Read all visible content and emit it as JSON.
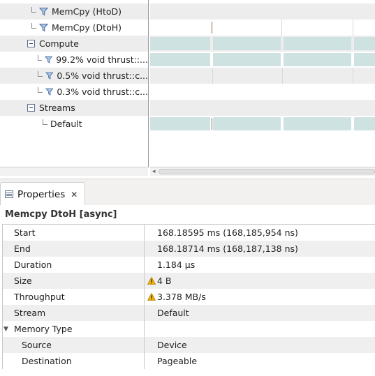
{
  "timeline": {
    "rows": [
      {
        "label": "MemCpy (HtoD)",
        "icon": "funnel-icon"
      },
      {
        "label": "MemCpy (DtoH)",
        "icon": "funnel-icon"
      },
      {
        "label": "Compute",
        "icon": "collapse-icon"
      },
      {
        "label": "99.2% void thrust::...",
        "icon": "funnel-icon"
      },
      {
        "label": "0.5% void thrust::c...",
        "icon": "funnel-icon"
      },
      {
        "label": "0.3% void thrust::c...",
        "icon": "funnel-icon"
      },
      {
        "label": "Streams",
        "icon": "collapse-icon"
      },
      {
        "label": "Default",
        "icon": "none"
      }
    ]
  },
  "properties": {
    "tab_label": "Properties",
    "tab_icon": "properties-list-icon",
    "close_icon": "close-icon",
    "header": "Memcpy DtoH [async]",
    "rows": [
      {
        "key": "Start",
        "value": "168.18595 ms (168,185,954 ns)"
      },
      {
        "key": "End",
        "value": "168.18714 ms (168,187,138 ns)"
      },
      {
        "key": "Duration",
        "value": "1.184 μs"
      },
      {
        "key": "Size",
        "value": "4 B",
        "warning": true
      },
      {
        "key": "Throughput",
        "value": "3.378 MB/s",
        "warning": true
      },
      {
        "key": "Stream",
        "value": "Default"
      },
      {
        "key": "Memory Type",
        "value": "",
        "expandable": true
      },
      {
        "key": "Source",
        "value": "Device",
        "child": true
      },
      {
        "key": "Destination",
        "value": "Pageable",
        "child": true
      }
    ]
  },
  "colors": {
    "kernel": "#cfe2e2",
    "row_shade": "#ededed",
    "warning": "#f0b400",
    "funnel": "#4a6fa0"
  }
}
